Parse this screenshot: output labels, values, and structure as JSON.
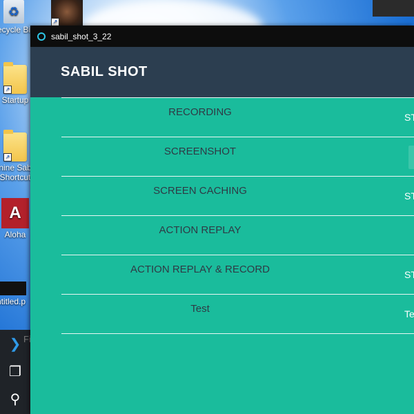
{
  "desktop": {
    "icons": [
      {
        "label": "ecycle Bi"
      },
      {
        "label": "Startup"
      },
      {
        "label": "nine Sab Shortcut"
      },
      {
        "label": "Aloha"
      },
      {
        "label": "ntitled.p"
      }
    ],
    "taskbar_partial_label": "Fi"
  },
  "window": {
    "title": "sabil_shot_3_22",
    "brand": "SABIL SHOT",
    "rows": [
      {
        "label": "RECORDING",
        "action": "STA"
      },
      {
        "label": "SCREENSHOT",
        "action": ""
      },
      {
        "label": "SCREEN CACHING",
        "action": "STA"
      },
      {
        "label": "ACTION REPLAY",
        "action": ""
      },
      {
        "label": "ACTION REPLAY & RECORD",
        "action": "STA"
      },
      {
        "label": "Test",
        "action": "Te"
      }
    ]
  },
  "colors": {
    "accent": "#1abc9c",
    "header": "#2c3e50",
    "titlebar": "#0d0d0d"
  }
}
